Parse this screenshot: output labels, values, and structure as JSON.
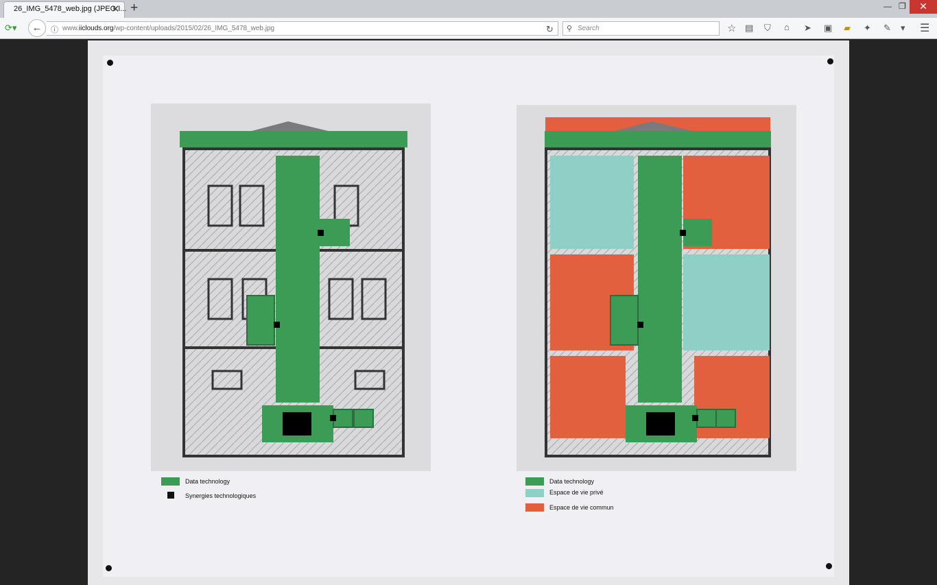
{
  "browser": {
    "tab_title": "26_IMG_5478_web.jpg (JPEG I...",
    "url_prefix": "www.",
    "url_domain": "iiclouds.org",
    "url_path": "/wp-content/uploads/2015/02/26_IMG_5478_web.jpg",
    "search_placeholder": "Search"
  },
  "figure": {
    "left_legend": [
      "Data technology",
      "Synergies technologiques"
    ],
    "right_legend": [
      "Data technology",
      "Espace de vie privé",
      "Espace de vie commun"
    ],
    "colors": {
      "data_technology": "#3c9c56",
      "synergies": "#111111",
      "private": "#8fd0c6",
      "common": "#e2603e"
    }
  }
}
